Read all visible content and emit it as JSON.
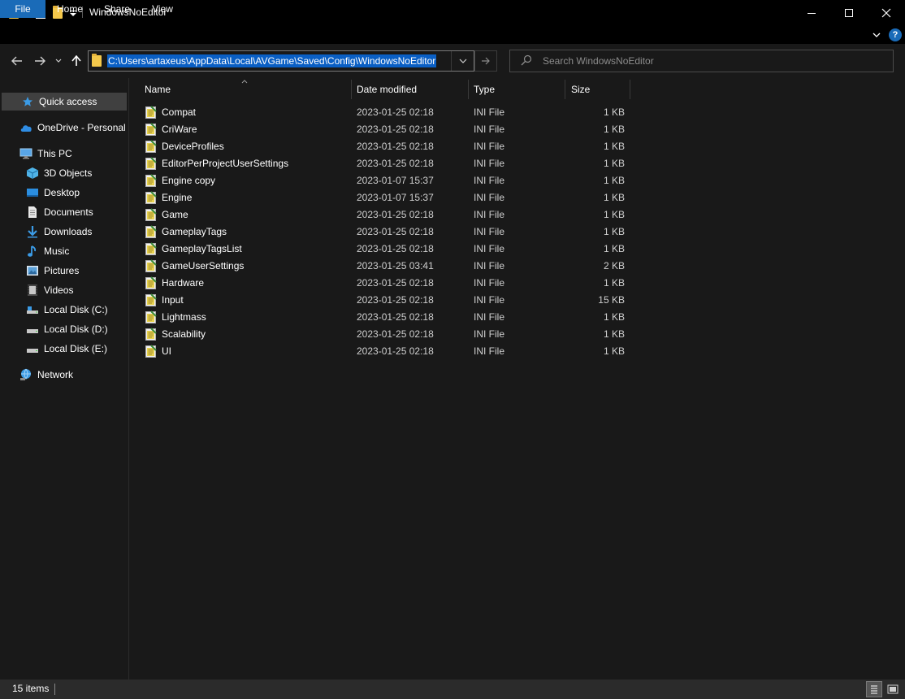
{
  "window": {
    "title": "WindowsNoEditor",
    "minimize_glyph": "—",
    "close_glyph": "✕"
  },
  "ribbon": {
    "tabs": [
      "File",
      "Home",
      "Share",
      "View"
    ],
    "expand_glyph": "⌄",
    "help_glyph": "?"
  },
  "address": {
    "path": "C:\\Users\\artaxeus\\AppData\\Local\\AVGame\\Saved\\Config\\WindowsNoEditor"
  },
  "search": {
    "placeholder": "Search WindowsNoEditor"
  },
  "sidebar": {
    "items": [
      {
        "label": "Quick access",
        "icon": "star-icon"
      },
      {
        "label": "OneDrive - Personal",
        "icon": "cloud-icon"
      },
      {
        "label": "This PC",
        "icon": "computer-icon"
      },
      {
        "label": "3D Objects",
        "icon": "cube-icon"
      },
      {
        "label": "Desktop",
        "icon": "desktop-icon"
      },
      {
        "label": "Documents",
        "icon": "document-icon"
      },
      {
        "label": "Downloads",
        "icon": "download-icon"
      },
      {
        "label": "Music",
        "icon": "music-icon"
      },
      {
        "label": "Pictures",
        "icon": "pictures-icon"
      },
      {
        "label": "Videos",
        "icon": "video-icon"
      },
      {
        "label": "Local Disk (C:)",
        "icon": "drive-icon"
      },
      {
        "label": "Local Disk (D:)",
        "icon": "drive-icon"
      },
      {
        "label": "Local Disk (E:)",
        "icon": "drive-icon"
      },
      {
        "label": "Network",
        "icon": "network-icon"
      }
    ]
  },
  "columns": {
    "name": "Name",
    "date": "Date modified",
    "type": "Type",
    "size": "Size"
  },
  "files": [
    {
      "name": "Compat",
      "date": "2023-01-25 02:18",
      "type": "INI File",
      "size": "1 KB"
    },
    {
      "name": "CriWare",
      "date": "2023-01-25 02:18",
      "type": "INI File",
      "size": "1 KB"
    },
    {
      "name": "DeviceProfiles",
      "date": "2023-01-25 02:18",
      "type": "INI File",
      "size": "1 KB"
    },
    {
      "name": "EditorPerProjectUserSettings",
      "date": "2023-01-25 02:18",
      "type": "INI File",
      "size": "1 KB"
    },
    {
      "name": "Engine copy",
      "date": "2023-01-07 15:37",
      "type": "INI File",
      "size": "1 KB"
    },
    {
      "name": "Engine",
      "date": "2023-01-07 15:37",
      "type": "INI File",
      "size": "1 KB"
    },
    {
      "name": "Game",
      "date": "2023-01-25 02:18",
      "type": "INI File",
      "size": "1 KB"
    },
    {
      "name": "GameplayTags",
      "date": "2023-01-25 02:18",
      "type": "INI File",
      "size": "1 KB"
    },
    {
      "name": "GameplayTagsList",
      "date": "2023-01-25 02:18",
      "type": "INI File",
      "size": "1 KB"
    },
    {
      "name": "GameUserSettings",
      "date": "2023-01-25 03:41",
      "type": "INI File",
      "size": "2 KB"
    },
    {
      "name": "Hardware",
      "date": "2023-01-25 02:18",
      "type": "INI File",
      "size": "1 KB"
    },
    {
      "name": "Input",
      "date": "2023-01-25 02:18",
      "type": "INI File",
      "size": "15 KB"
    },
    {
      "name": "Lightmass",
      "date": "2023-01-25 02:18",
      "type": "INI File",
      "size": "1 KB"
    },
    {
      "name": "Scalability",
      "date": "2023-01-25 02:18",
      "type": "INI File",
      "size": "1 KB"
    },
    {
      "name": "UI",
      "date": "2023-01-25 02:18",
      "type": "INI File",
      "size": "1 KB"
    }
  ],
  "status": {
    "item_count": "15 items"
  },
  "colors": {
    "background": "#191919",
    "titlebar": "#000000",
    "accent": "#1a6bb8",
    "selection": "#0a5fc4",
    "folder": "#f4c84b"
  }
}
